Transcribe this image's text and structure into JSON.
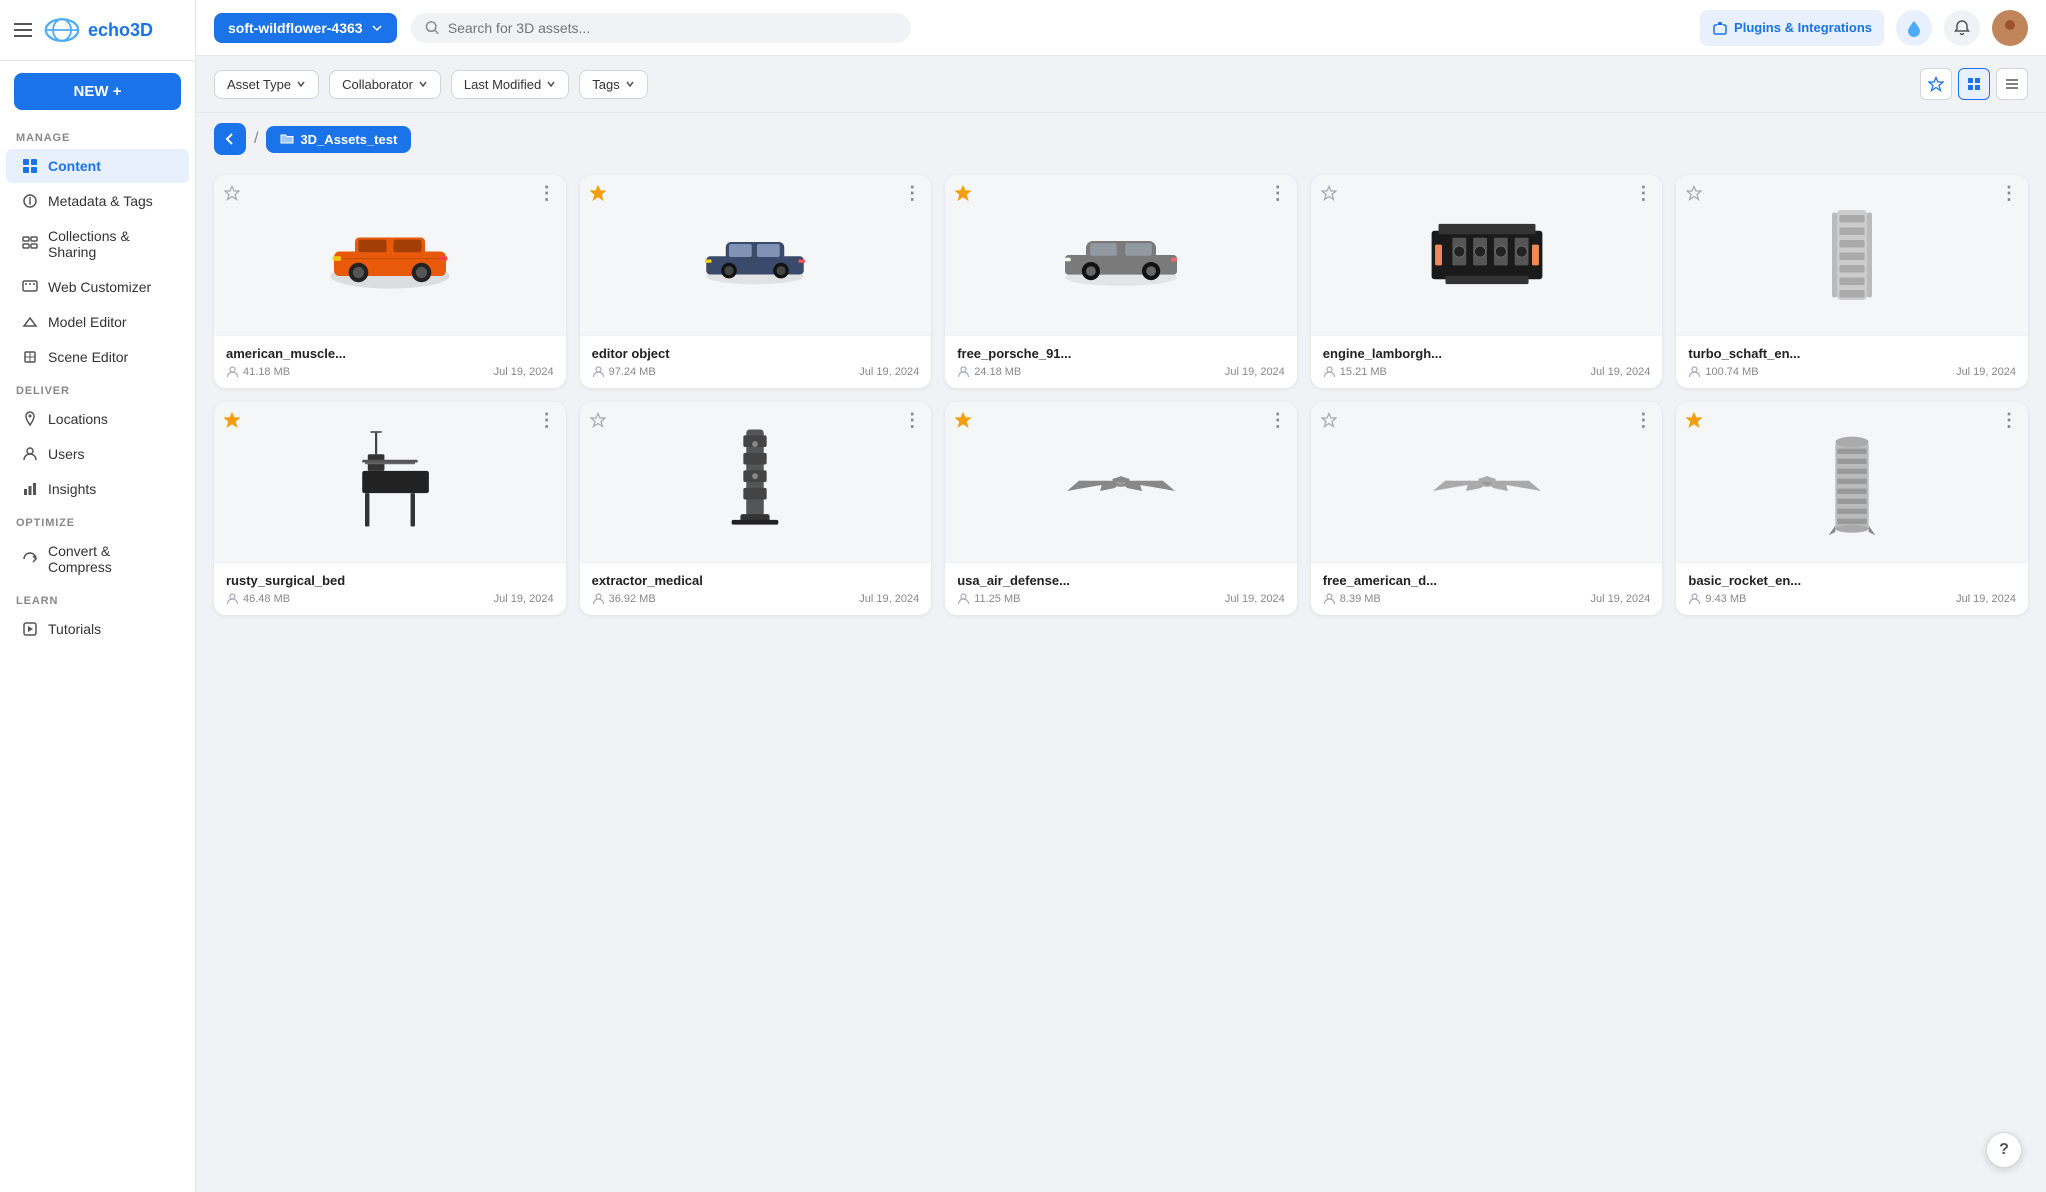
{
  "topnav": {
    "workspace": "soft-wildflower-4363",
    "search_placeholder": "Search for 3D assets...",
    "plugins_label": "Plugins & Integrations"
  },
  "toolbar": {
    "filters": [
      {
        "id": "asset-type",
        "label": "Asset Type"
      },
      {
        "id": "collaborator",
        "label": "Collaborator"
      },
      {
        "id": "last-modified",
        "label": "Last Modified"
      },
      {
        "id": "tags",
        "label": "Tags"
      }
    ]
  },
  "breadcrumb": {
    "back_label": "←",
    "separator": "/",
    "folder_label": "3D_Assets_test"
  },
  "sidebar": {
    "new_button": "NEW +",
    "sections": [
      {
        "label": "MANAGE",
        "items": [
          {
            "id": "content",
            "label": "Content",
            "active": true
          },
          {
            "id": "metadata",
            "label": "Metadata & Tags"
          },
          {
            "id": "collections",
            "label": "Collections & Sharing"
          },
          {
            "id": "web-customizer",
            "label": "Web Customizer"
          },
          {
            "id": "model-editor",
            "label": "Model Editor"
          },
          {
            "id": "scene-editor",
            "label": "Scene Editor"
          }
        ]
      },
      {
        "label": "DELIVER",
        "items": [
          {
            "id": "locations",
            "label": "Locations"
          },
          {
            "id": "users",
            "label": "Users"
          },
          {
            "id": "insights",
            "label": "Insights"
          }
        ]
      },
      {
        "label": "OPTIMIZE",
        "items": [
          {
            "id": "convert",
            "label": "Convert & Compress"
          }
        ]
      },
      {
        "label": "LEARN",
        "items": [
          {
            "id": "tutorials",
            "label": "Tutorials"
          }
        ]
      }
    ]
  },
  "assets": [
    {
      "id": "1",
      "name": "american_muscle...",
      "size": "41.18 MB",
      "date": "Jul 19, 2024",
      "starred": false,
      "color": "#e85a0a",
      "shape": "car-muscle"
    },
    {
      "id": "2",
      "name": "editor object",
      "size": "97.24 MB",
      "date": "Jul 19, 2024",
      "starred": true,
      "color": "#3a4a6b",
      "shape": "car-sedan"
    },
    {
      "id": "3",
      "name": "free_porsche_91...",
      "size": "24.18 MB",
      "date": "Jul 19, 2024",
      "starred": true,
      "color": "#7a7a7a",
      "shape": "car-sports"
    },
    {
      "id": "4",
      "name": "engine_lamborgh...",
      "size": "15.21 MB",
      "date": "Jul 19, 2024",
      "starred": false,
      "color": "#222",
      "shape": "engine"
    },
    {
      "id": "5",
      "name": "turbo_schaft_en...",
      "size": "100.74 MB",
      "date": "Jul 19, 2024",
      "starred": false,
      "color": "#ccc",
      "shape": "engine-turbo"
    },
    {
      "id": "6",
      "name": "rusty_surgical_bed",
      "size": "46.48 MB",
      "date": "Jul 19, 2024",
      "starred": true,
      "color": "#333",
      "shape": "surgical-bed"
    },
    {
      "id": "7",
      "name": "extractor_medical",
      "size": "36.92 MB",
      "date": "Jul 19, 2024",
      "starred": false,
      "color": "#555",
      "shape": "medical-device"
    },
    {
      "id": "8",
      "name": "usa_air_defense...",
      "size": "11.25 MB",
      "date": "Jul 19, 2024",
      "starred": true,
      "color": "#888",
      "shape": "aircraft"
    },
    {
      "id": "9",
      "name": "free_american_d...",
      "size": "8.39 MB",
      "date": "Jul 19, 2024",
      "starred": false,
      "color": "#aaa",
      "shape": "aircraft2"
    },
    {
      "id": "10",
      "name": "basic_rocket_en...",
      "size": "9.43 MB",
      "date": "Jul 19, 2024",
      "starred": true,
      "color": "#bbb",
      "shape": "rocket"
    }
  ]
}
